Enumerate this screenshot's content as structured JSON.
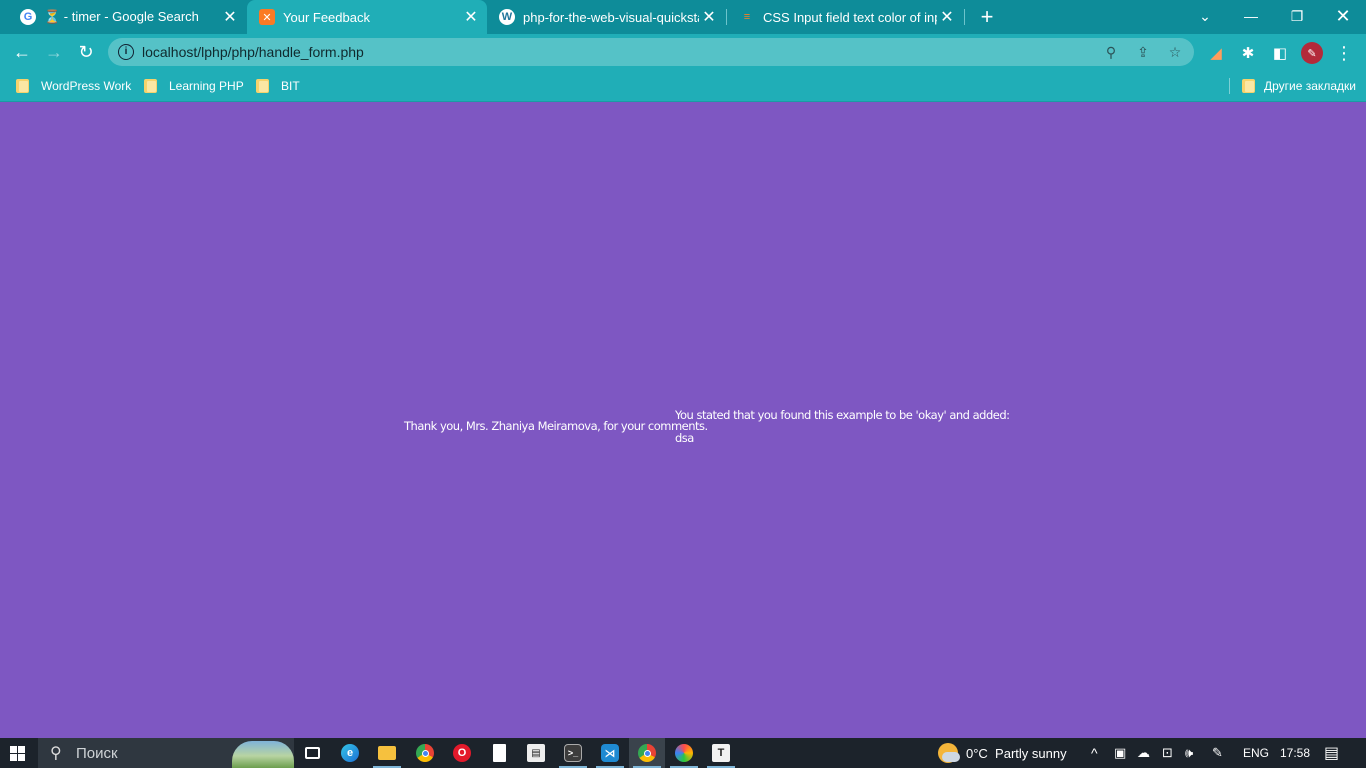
{
  "browser": {
    "tabs": [
      {
        "title": "⏳ - timer - Google Search",
        "favicon": "google-icon"
      },
      {
        "title": "Your Feedback",
        "favicon": "xampp-icon"
      },
      {
        "title": "php-for-the-web-visual-quickstart",
        "favicon": "wordpress-icon"
      },
      {
        "title": "CSS Input field text color of input",
        "favicon": "stackoverflow-icon"
      }
    ],
    "active_tab": 1,
    "url": "localhost/lphp/php/handle_form.php",
    "bookmarks": [
      "WordPress Work",
      "Learning PHP",
      "BIT"
    ],
    "other_bookmarks": "Другие закладки"
  },
  "page": {
    "background": "#7e57c2",
    "thank_you": "Thank you, Mrs. Zhaniya Meiramova, for your comments.",
    "stated": "You stated that you found this example to be 'okay' and added:",
    "comment": "dsa"
  },
  "taskbar": {
    "search_placeholder": "Поиск",
    "weather": "0°C  Partly sunny",
    "language": "ENG",
    "time": "17:58"
  }
}
